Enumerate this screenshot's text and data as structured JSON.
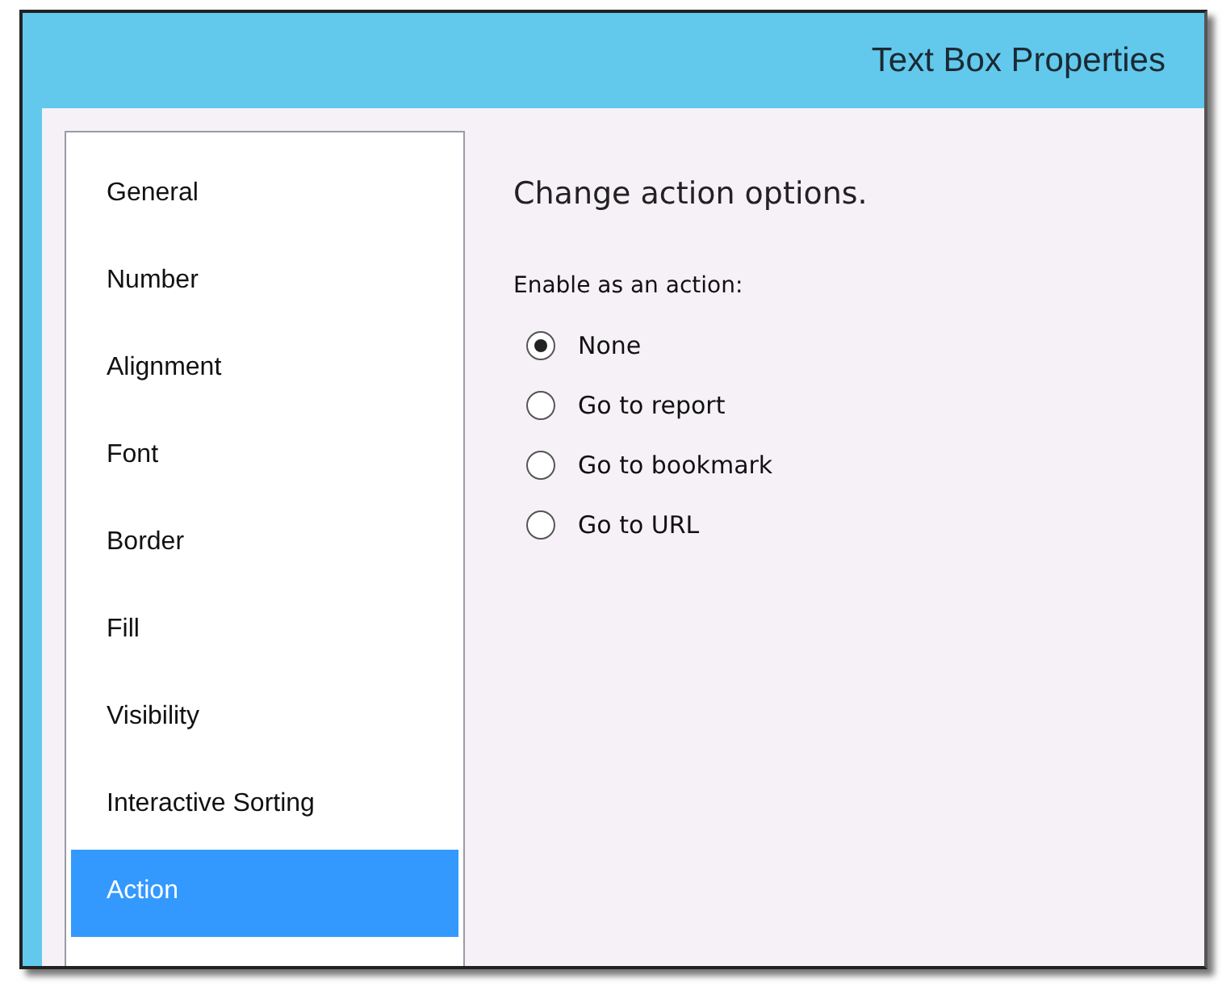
{
  "window": {
    "title": "Text Box Properties"
  },
  "sidebar": {
    "items": [
      {
        "label": "General",
        "selected": false
      },
      {
        "label": "Number",
        "selected": false
      },
      {
        "label": "Alignment",
        "selected": false
      },
      {
        "label": "Font",
        "selected": false
      },
      {
        "label": "Border",
        "selected": false
      },
      {
        "label": "Fill",
        "selected": false
      },
      {
        "label": "Visibility",
        "selected": false
      },
      {
        "label": "Interactive Sorting",
        "selected": false
      },
      {
        "label": "Action",
        "selected": true
      }
    ]
  },
  "panel": {
    "heading": "Change action options.",
    "group_label": "Enable as an action:",
    "options": [
      {
        "label": "None",
        "selected": true
      },
      {
        "label": "Go to report",
        "selected": false
      },
      {
        "label": "Go to bookmark",
        "selected": false
      },
      {
        "label": "Go to URL",
        "selected": false
      }
    ]
  }
}
